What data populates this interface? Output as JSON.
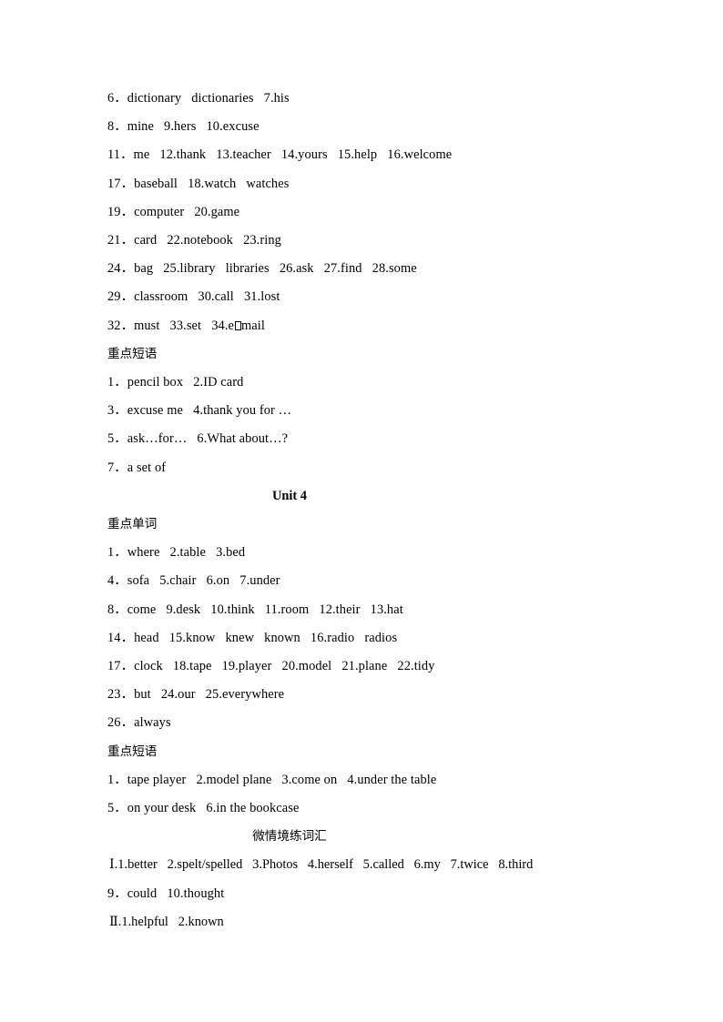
{
  "document": {
    "background_color": "#ffffff",
    "text_color": "#000000"
  },
  "unit3_words_continued": [
    "6．dictionary   dictionaries   7.his",
    "8．mine   9.hers   10.excuse",
    "11．me   12.thank   13.teacher   14.yours   15.help   16.welcome",
    "17．baseball   18.watch   watches",
    "19．computer   20.game",
    "21．card   22.notebook   23.ring",
    "24．bag   25.library   libraries   26.ask   27.find   28.some",
    "29．classroom   30.call   31.lost"
  ],
  "unit3_last_word_line": {
    "before_tofu": "32．must   33.set   34.e",
    "after_tofu": "mail"
  },
  "unit3_phrases_heading": "重点短语",
  "unit3_phrases": [
    "1．pencil box   2.ID card",
    "3．excuse me   4.thank you for …",
    "5．ask…for…   6.What about…?",
    "7．a set of"
  ],
  "unit4_title": "Unit 4",
  "unit4_words_heading": "重点单词",
  "unit4_words": [
    "1．where   2.table   3.bed",
    "4．sofa   5.chair   6.on   7.under",
    "8．come   9.desk   10.think   11.room   12.their   13.hat",
    "14．head   15.know   knew   known   16.radio   radios",
    "17．clock   18.tape   19.player   20.model   21.plane   22.tidy",
    "23．but   24.our   25.everywhere",
    "26．always"
  ],
  "unit4_phrases_heading": "重点短语",
  "unit4_phrases": [
    "1．tape player   2.model plane   3.come on   4.under the table",
    "5．on your desk   6.in the bookcase"
  ],
  "vocab_section_title": "微情境练词汇",
  "vocab_exercises": [
    "Ⅰ.1.better   2.spelt/spelled   3.Photos   4.herself   5.called   6.my   7.twice   8.third",
    "9．could   10.thought",
    "Ⅱ.1.helpful   2.known"
  ]
}
